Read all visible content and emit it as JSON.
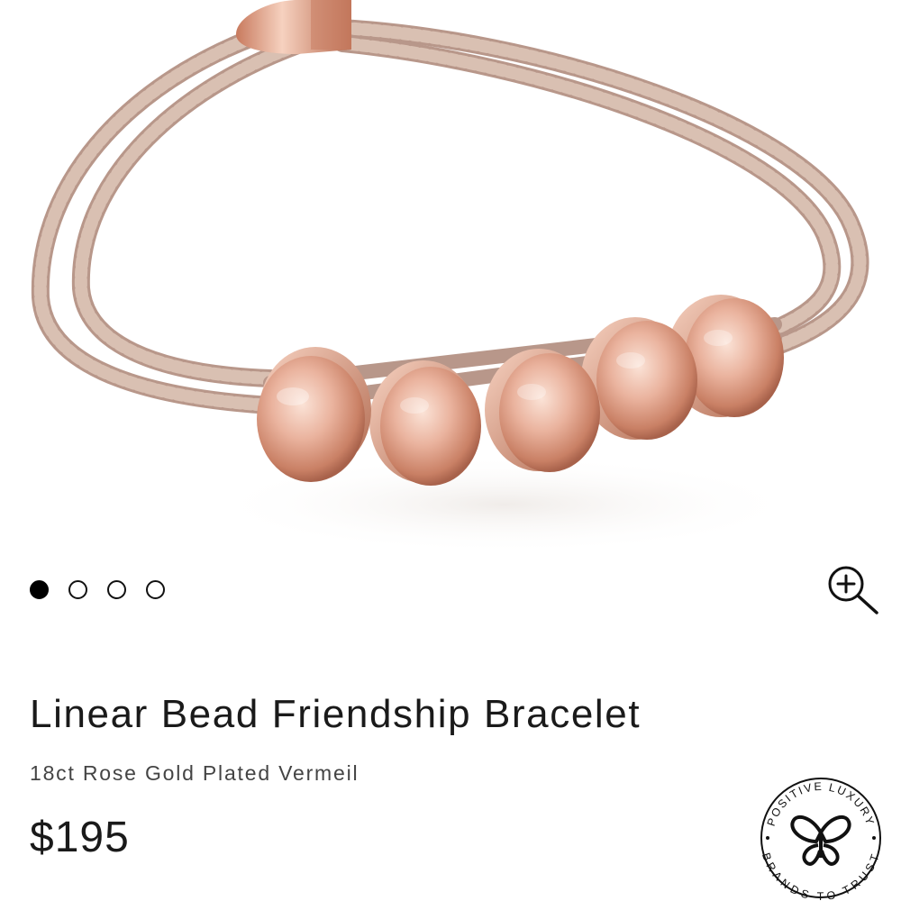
{
  "product": {
    "title": "Linear Bead Friendship Bracelet",
    "subtitle": "18ct Rose Gold Plated Vermeil",
    "price": "$195"
  },
  "gallery": {
    "image_count": 4,
    "active_index": 0
  },
  "icons": {
    "zoom": "zoom-in-icon",
    "badge": "butterfly-icon"
  },
  "badge": {
    "top_text": "POSITIVE LUXURY",
    "bottom_text": "BRANDS TO TRUST"
  },
  "colors": {
    "rose_gold": "#e2a690",
    "cord": "#c9ab9b",
    "text": "#1a1a1a",
    "active_dot": "#000000"
  }
}
